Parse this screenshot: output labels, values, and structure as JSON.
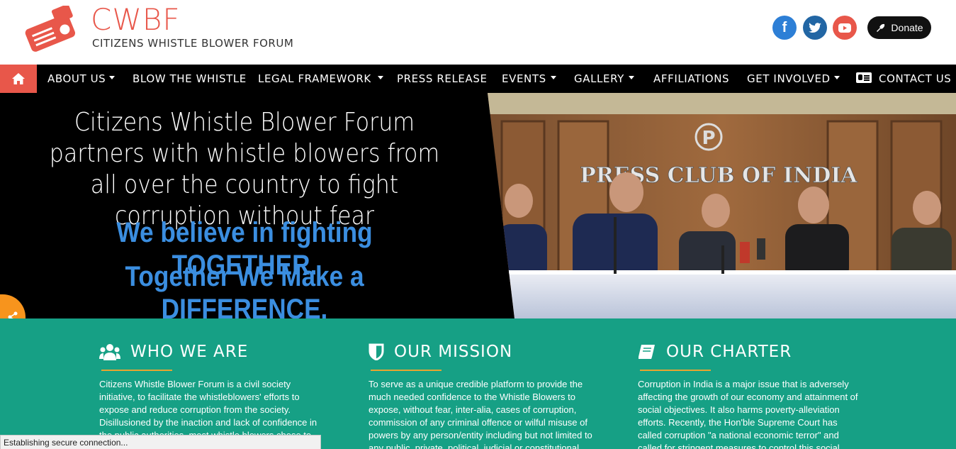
{
  "brand": {
    "abbr": "CWBF",
    "name": "CITIZENS WHISTLE BLOWER FORUM",
    "accent": "#e8574a"
  },
  "social": {
    "facebook": {
      "icon": "facebook-icon",
      "glyph": "f",
      "color": "#2d7fd6"
    },
    "twitter": {
      "icon": "twitter-icon",
      "color": "#2266a4"
    },
    "youtube": {
      "icon": "youtube-icon",
      "color": "#e8574a"
    }
  },
  "donate": {
    "label": "Donate"
  },
  "nav": {
    "home_icon": "home-icon",
    "items": [
      {
        "label": "ABOUT US",
        "dropdown": true
      },
      {
        "label": "BLOW THE WHISTLE",
        "dropdown": false
      },
      {
        "label": "LEGAL FRAMEWORK",
        "dropdown": true
      },
      {
        "label": "PRESS RELEASE",
        "dropdown": false
      },
      {
        "label": "EVENTS",
        "dropdown": true
      },
      {
        "label": "GALLERY",
        "dropdown": true
      },
      {
        "label": "AFFILIATIONS",
        "dropdown": false
      },
      {
        "label": "GET INVOLVED",
        "dropdown": true
      },
      {
        "label": "CONTACT US",
        "dropdown": false
      }
    ]
  },
  "hero": {
    "headline": "Citizens Whistle Blower Forum partners with whistle blowers from all over the country to fight corruption without fear",
    "slogan1": "We believe in fighting TOGETHER.",
    "slogan2": "Together We Make a DIFFERENCE.",
    "photo_sign": "PRESS CLUB OF INDIA",
    "photo_logo": "P",
    "slogan_color": "#3b8ee0"
  },
  "share": {
    "icon": "share-icon"
  },
  "sections": [
    {
      "title": "WHO WE ARE",
      "icon": "users-icon",
      "text": "Citizens Whistle Blower Forum is a civil society initiative, to facilitate the whistleblowers' efforts to expose and reduce corruption from the society. Disillusioned by the inaction and lack of confidence in the public authorities, most whistle blowers chose to remain silent. To fill this"
    },
    {
      "title": "OUR MISSION",
      "icon": "shield-icon",
      "text": "To serve as a unique credible platform to provide the much needed confidence to the Whistle Blowers to expose, without fear, inter-alia, cases of corruption, commission of any criminal offence or wilful misuse of powers by any person/entity including but not limited to any public, private, political, judicial or constitutional"
    },
    {
      "title": "OUR CHARTER",
      "icon": "book-icon",
      "text": "Corruption in India is a major issue that is adversely affecting the growth of our economy and attainment of social objectives. It also harms poverty-alleviation efforts. Recently, the Hon'ble Supreme Court has called corruption \"a national economic terror\" and called for stringent measures to control this social calamity. In"
    }
  ],
  "status_bar": {
    "text": "Establishing secure connection..."
  },
  "colors": {
    "teal": "#16a085",
    "nav": "#000000",
    "rule": "#e8a530",
    "share": "#f7941d"
  }
}
